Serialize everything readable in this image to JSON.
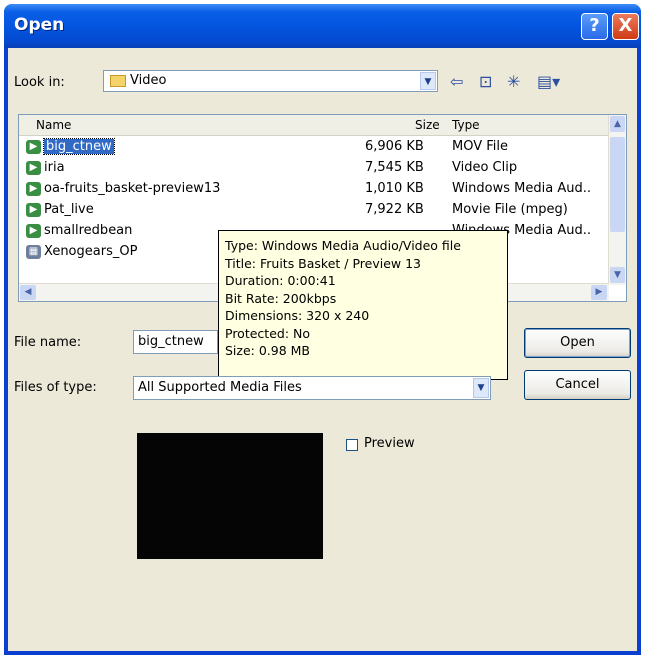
{
  "window": {
    "title": "Open",
    "help_glyph": "?",
    "close_glyph": "X"
  },
  "look_in": {
    "label": "Look in:",
    "value": "Video"
  },
  "toolbar": {
    "icons": [
      "back-arrow-icon",
      "up-folder-icon",
      "new-folder-icon",
      "view-menu-icon"
    ]
  },
  "file_list": {
    "columns": [
      "Name",
      "Size",
      "Type"
    ],
    "rows": [
      {
        "name": "big_ctnew",
        "size": "6,906 KB",
        "type": "MOV File",
        "icon": "movie-file-icon",
        "selected": true
      },
      {
        "name": "iria",
        "size": "7,545 KB",
        "type": "Video Clip",
        "icon": "video-clip-icon"
      },
      {
        "name": "oa-fruits_basket-preview13",
        "size": "1,010 KB",
        "type": "Windows Media Aud..",
        "icon": "media-file-icon"
      },
      {
        "name": "Pat_live",
        "size": "7,922 KB",
        "type": "Movie File (mpeg)",
        "icon": "media-file-icon"
      },
      {
        "name": "smallredbean",
        "size": "",
        "type": "Windows Media Aud..",
        "icon": "media-file-icon"
      },
      {
        "name": "Xenogears_OP",
        "size": "",
        "type": "",
        "icon": "film-file-icon"
      }
    ]
  },
  "tooltip": {
    "lines": [
      "Type: Windows Media Audio/Video file",
      "Title: Fruits Basket / Preview 13",
      "Duration: 0:00:41",
      "Bit Rate: 200kbps",
      "Dimensions: 320 x 240",
      "Protected: No",
      "Size: 0.98 MB"
    ]
  },
  "file_name": {
    "label": "File name:",
    "value": "big_ctnew"
  },
  "files_of_type": {
    "label": "Files of type:",
    "value": "All Supported Media Files"
  },
  "buttons": {
    "open": "Open",
    "cancel": "Cancel"
  },
  "preview": {
    "label": "Preview",
    "checked": false
  }
}
